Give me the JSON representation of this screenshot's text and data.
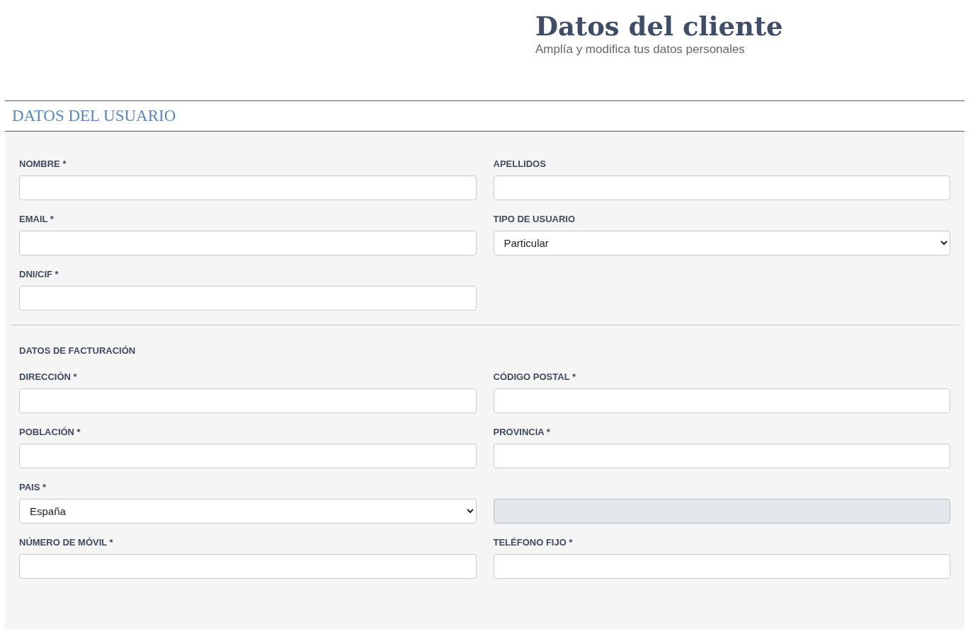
{
  "header": {
    "title": "Datos del cliente",
    "subtitle": "Amplía y modifica tus datos personales"
  },
  "section": {
    "title": "DATOS DEL USUARIO"
  },
  "groups": [
    {
      "fields": [
        {
          "label": "NOMBRE *",
          "kind": "text",
          "disabled": false
        },
        {
          "label": "APELLIDOS",
          "kind": "text",
          "disabled": false
        },
        {
          "label": "EMAIL *",
          "kind": "text",
          "disabled": false
        },
        {
          "label": "TIPO DE USUARIO",
          "kind": "select",
          "value": "Particular",
          "disabled": false
        },
        {
          "label": "DNI/CIF *",
          "kind": "text",
          "disabled": false
        }
      ]
    },
    {
      "title": "DATOS DE FACTURACIÓN",
      "fields": [
        {
          "label": "DIRECCIÓN *",
          "kind": "text",
          "disabled": false
        },
        {
          "label": "CÓDIGO POSTAL *",
          "kind": "text",
          "disabled": false
        },
        {
          "label": "POBLACIÓN *",
          "kind": "text",
          "disabled": false
        },
        {
          "label": "PROVINCIA *",
          "kind": "text",
          "disabled": false
        },
        {
          "label": "PAIS *",
          "kind": "select",
          "value": "España",
          "disabled": false
        },
        {
          "kind": "text",
          "disabled": true
        },
        {
          "label": "NÚMERO DE MÓVIL *",
          "kind": "text",
          "disabled": false
        },
        {
          "label": "TELÉFONO FIJO *",
          "kind": "text",
          "disabled": false
        }
      ]
    }
  ]
}
